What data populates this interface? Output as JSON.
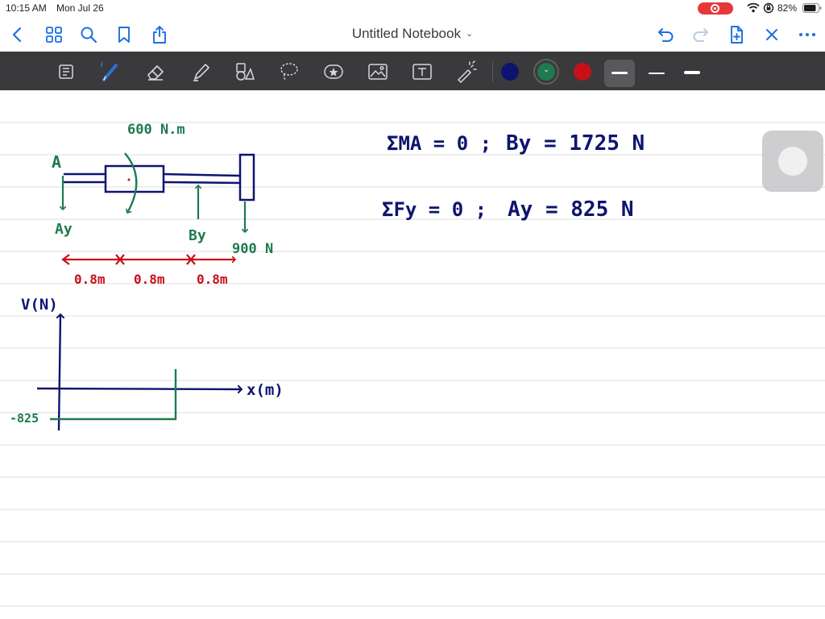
{
  "status": {
    "time": "10:15 AM",
    "date": "Mon Jul 26",
    "battery": "82%"
  },
  "nav": {
    "title": "Untitled Notebook",
    "icons": [
      "back-icon",
      "grid-icon",
      "search-icon",
      "bookmark-icon",
      "share-icon",
      "undo-icon",
      "redo-icon",
      "add-page-icon",
      "close-icon",
      "more-icon"
    ]
  },
  "toolbar": {
    "tools": [
      "read-mode-icon",
      "pen-icon",
      "eraser-icon",
      "highlighter-icon",
      "shapes-icon",
      "lasso-icon",
      "sticker-icon",
      "image-icon",
      "text-icon",
      "laser-pointer-icon"
    ],
    "colors": [
      "#0d1470",
      "#1f7a4f",
      "#c8101a"
    ],
    "selected_color": "#1f7a4f"
  },
  "notes": {
    "moment_label": "600 N.m",
    "point_a": "A",
    "ay_label": "Ay",
    "by_label": "By",
    "load_label": "900 N",
    "dim1": "0.8m",
    "dim2": "0.8m",
    "dim3": "0.8m",
    "eq1_left": "ΣMA = 0 ;",
    "eq1_right": "By = 1725 N",
    "eq2_left": "ΣFy = 0 ;",
    "eq2_right": "Ay = 825 N",
    "y_axis_label": "V(N)",
    "x_axis_label": "x(m)",
    "shear_value": "-825"
  }
}
